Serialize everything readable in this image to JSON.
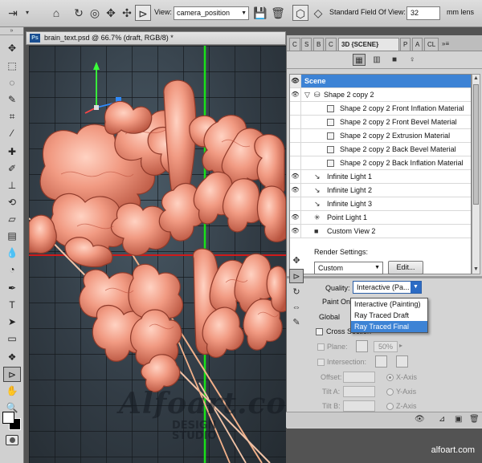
{
  "options_bar": {
    "view_label": "View:",
    "view_value": "camera_position",
    "fov_label": "Standard Field Of View:",
    "fov_value": "32",
    "fov_unit_value": "mm lens"
  },
  "document": {
    "tab_title": "brain_text.psd @ 66.7% (draft, RGB/8) *",
    "ps_badge": "Ps",
    "watermark_main": "Alfoart.com",
    "watermark_sub_1": "DESIGN",
    "watermark_sub_2": "STUDIO"
  },
  "panel": {
    "tabs": [
      {
        "label": "C"
      },
      {
        "label": "S"
      },
      {
        "label": "B"
      },
      {
        "label": "C"
      },
      {
        "label": "3D {SCENE}"
      },
      {
        "label": "P"
      },
      {
        "label": "A"
      },
      {
        "label": "CL"
      }
    ],
    "scene_items": [
      {
        "label": "Scene",
        "selected": true
      },
      {
        "label": "Shape 2 copy 2",
        "icon": "mesh-icon"
      },
      {
        "label": "Shape 2 copy 2 Front Inflation Material"
      },
      {
        "label": "Shape 2 copy 2 Front Bevel Material"
      },
      {
        "label": "Shape 2 copy 2 Extrusion Material"
      },
      {
        "label": "Shape 2 copy 2 Back Bevel Material"
      },
      {
        "label": "Shape 2 copy 2 Back Inflation Material"
      },
      {
        "label": "Infinite Light 1"
      },
      {
        "label": "Infinite Light 2"
      },
      {
        "label": "Infinite Light 3"
      },
      {
        "label": "Point Light 1"
      },
      {
        "label": "Custom View 2"
      }
    ],
    "render_settings_label": "Render Settings:",
    "render_preset": "Custom",
    "edit_button": "Edit...",
    "quality_label": "Quality:",
    "quality_value": "Interactive (Pa...",
    "quality_options": [
      "Interactive (Painting)",
      "Ray Traced Draft",
      "Ray Traced Final"
    ],
    "paint_on_label": "Paint On:",
    "global_label": "Global",
    "cross_section_label": "Cross Section",
    "plane_label": "Plane:",
    "plane_value": "50%",
    "intersection_label": "Intersection:",
    "offset_label": "Offset:",
    "tilt_a_label": "Tilt A:",
    "tilt_b_label": "Tilt B:",
    "x_axis_label": "X-Axis",
    "y_axis_label": "Y-Axis",
    "z_axis_label": "Z-Axis"
  },
  "credit": "alfoart.com"
}
